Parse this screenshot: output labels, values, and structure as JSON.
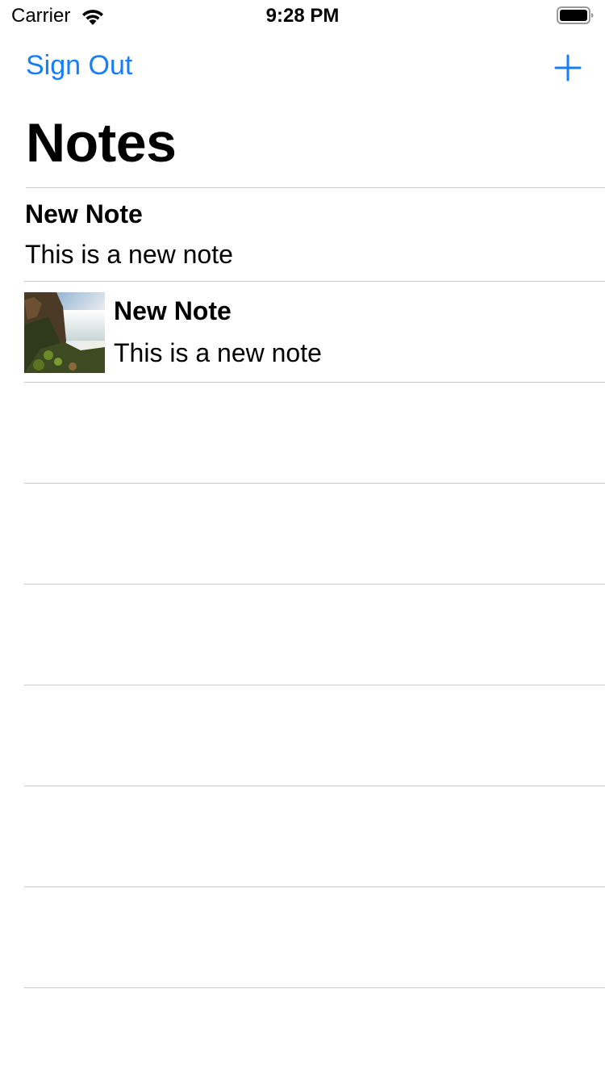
{
  "status_bar": {
    "carrier": "Carrier",
    "time": "9:28 PM"
  },
  "nav": {
    "left_button": "Sign Out",
    "add_icon": "plus-icon",
    "tint_color": "#147efb"
  },
  "title": "Notes",
  "notes": [
    {
      "title": "New Note",
      "body": "This is a new note",
      "has_image": false
    },
    {
      "title": "New Note",
      "body": "This is a new note",
      "has_image": true,
      "image": "waterfall-thumbnail"
    }
  ]
}
